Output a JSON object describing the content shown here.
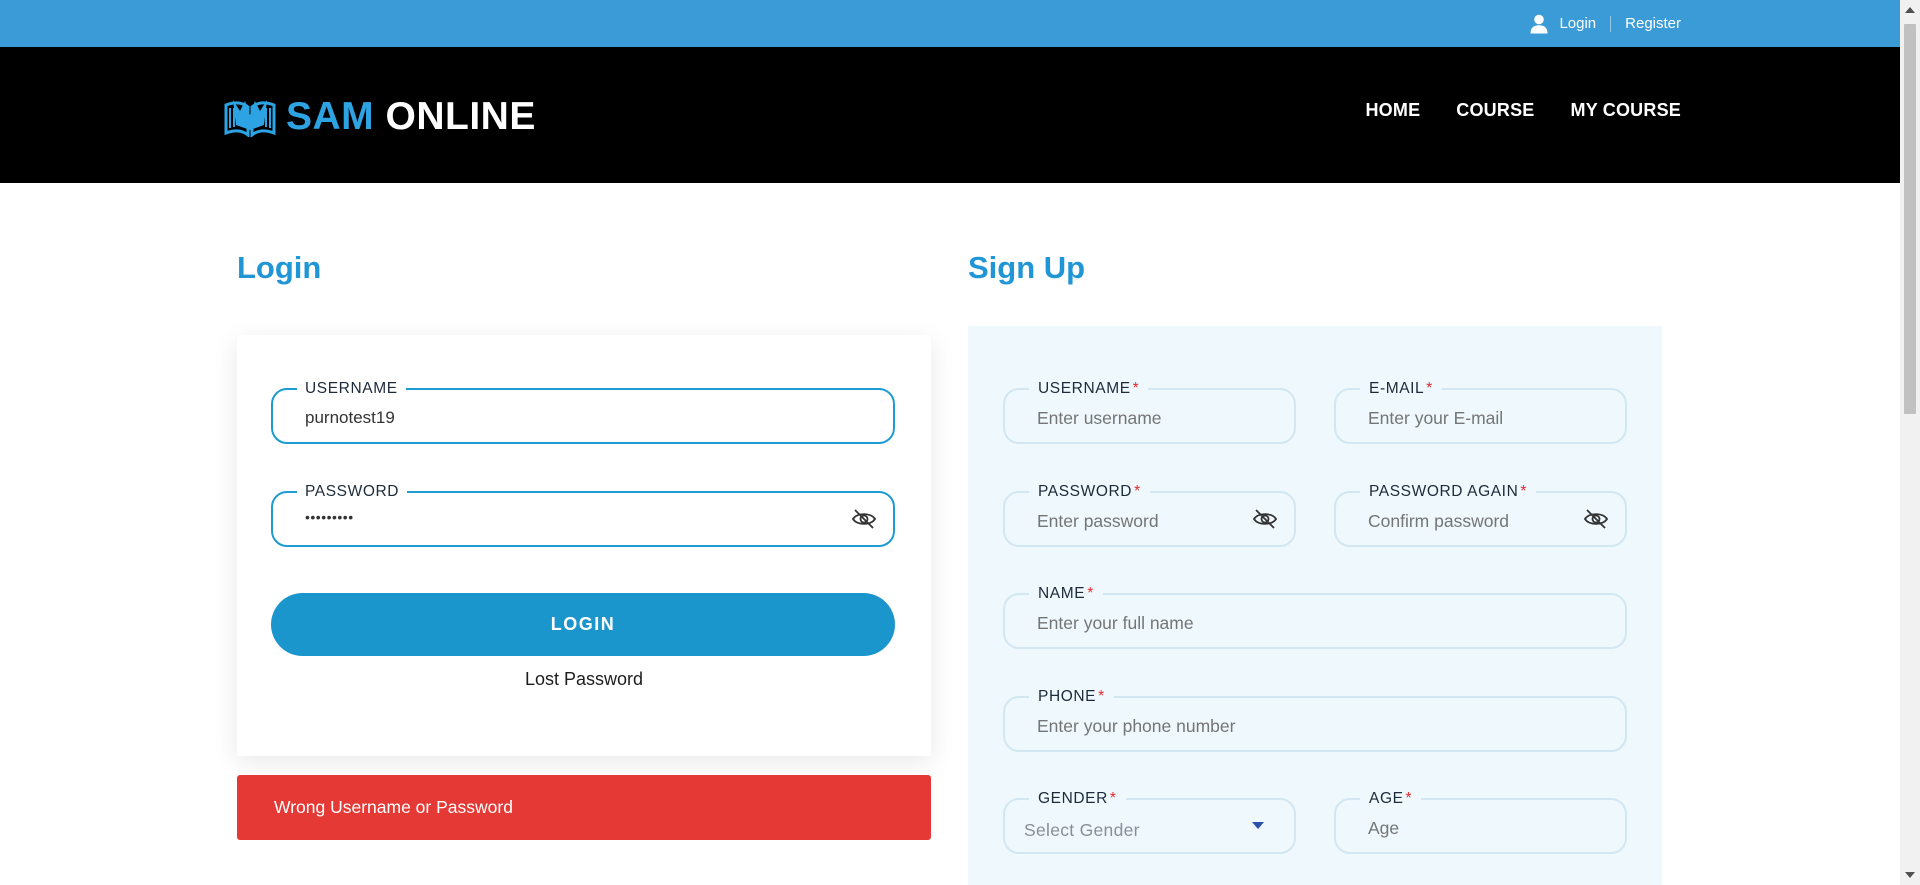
{
  "topbar": {
    "login_label": "Login",
    "register_label": "Register"
  },
  "header": {
    "logo_primary": "SAM",
    "logo_secondary": "ONLINE",
    "nav": [
      "HOME",
      "COURSE",
      "MY COURSE"
    ]
  },
  "login": {
    "title": "Login",
    "username_label": "USERNAME",
    "username_value": "purnotest19",
    "password_label": "PASSWORD",
    "password_value": "•••••••••",
    "button_label": "LOGIN",
    "lost_password": "Lost Password",
    "error_message": "Wrong Username or Password"
  },
  "signup": {
    "title": "Sign Up",
    "username": {
      "label": "USERNAME",
      "placeholder": "Enter username"
    },
    "email": {
      "label": "E-MAIL",
      "placeholder": "Enter your E-mail"
    },
    "password": {
      "label": "PASSWORD",
      "placeholder": "Enter password"
    },
    "password_again": {
      "label": "PASSWORD AGAIN",
      "placeholder": "Confirm password"
    },
    "name": {
      "label": "NAME",
      "placeholder": "Enter your full name"
    },
    "phone": {
      "label": "PHONE",
      "placeholder": "Enter your phone number"
    },
    "gender": {
      "label": "GENDER",
      "selected": "Select Gender"
    },
    "age": {
      "label": "AGE",
      "placeholder": "Age"
    },
    "required_mark": "*"
  },
  "colors": {
    "topbar": "#3b9bd6",
    "header": "#000000",
    "accent": "#2096d6",
    "button": "#1b96cc",
    "error": "#e53935",
    "signup_bg": "#eef8fd",
    "required": "#e52a2a"
  },
  "icons": {
    "user": "user-icon",
    "eye_off": "eye-off-icon",
    "logo": "book-logo-icon",
    "dropdown": "chevron-down-icon"
  }
}
